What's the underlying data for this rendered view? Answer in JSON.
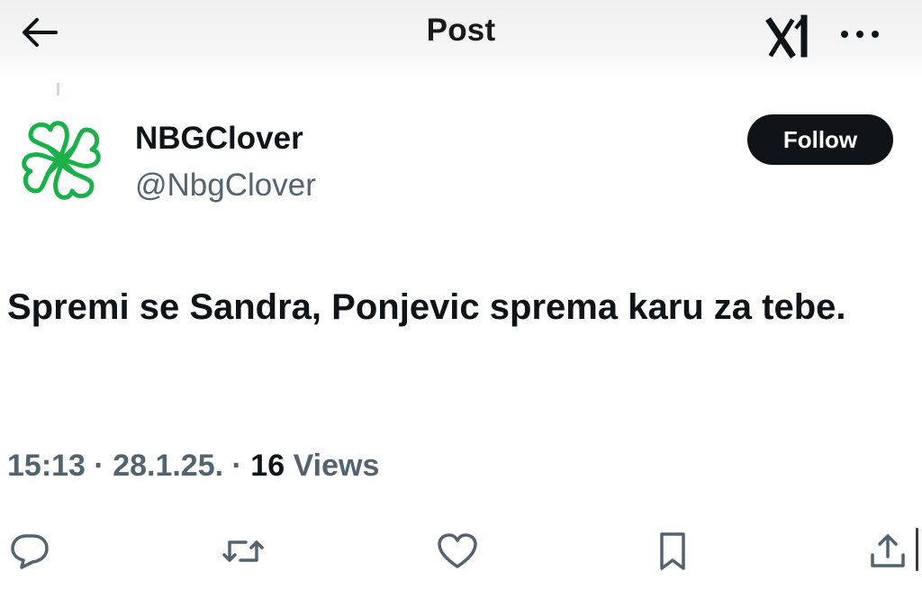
{
  "header": {
    "title": "Post",
    "back_icon": "arrow-left-icon",
    "grok_icon": "grok-icon",
    "more_icon": "more-horizontal-icon"
  },
  "post": {
    "author": {
      "display_name": "NBGClover",
      "handle": "@NbgClover",
      "avatar_icon": "clover-logo-icon"
    },
    "follow_label": "Follow",
    "text": "Spremi se Sandra, Ponjevic sprema karu za tebe.",
    "time": "15:13",
    "date": "28.1.25.",
    "separator": " · ",
    "views_count": "16",
    "views_label": "Views"
  },
  "actions": [
    {
      "name": "reply",
      "icon": "reply-icon"
    },
    {
      "name": "repost",
      "icon": "repost-icon"
    },
    {
      "name": "like",
      "icon": "heart-icon"
    },
    {
      "name": "bookmark",
      "icon": "bookmark-icon"
    },
    {
      "name": "share",
      "icon": "share-icon"
    }
  ],
  "colors": {
    "text_primary": "#0f1419",
    "text_secondary": "#536471",
    "follow_bg": "#0f1419",
    "brand_green": "#1bb04a"
  }
}
